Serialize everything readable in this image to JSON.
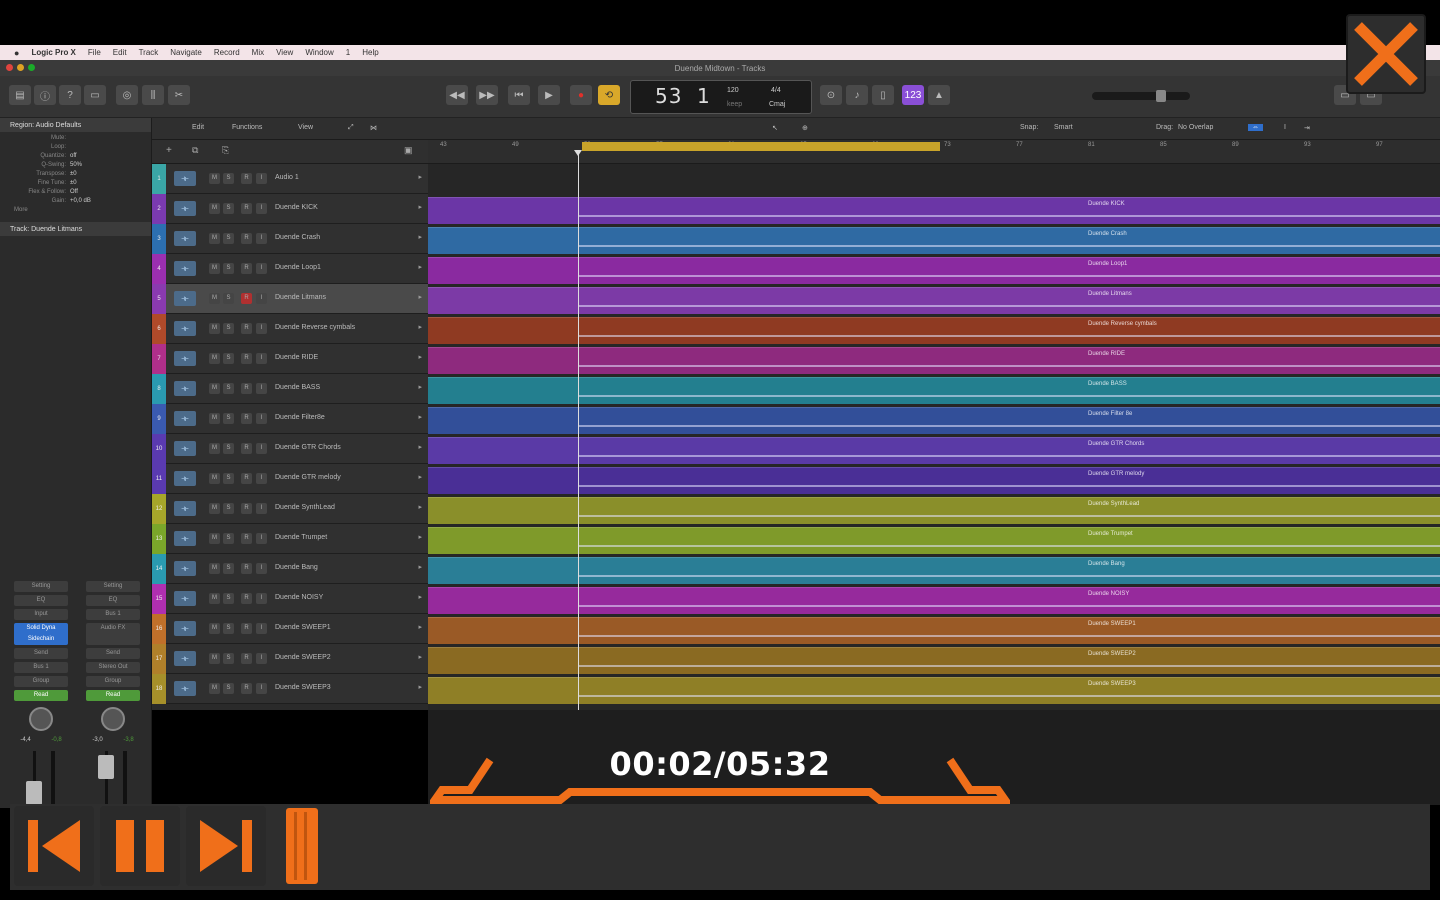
{
  "menubar": {
    "app_name": "Logic Pro X",
    "items": [
      "File",
      "Edit",
      "Track",
      "Navigate",
      "Record",
      "Mix",
      "View",
      "Window",
      "1",
      "Help"
    ]
  },
  "window": {
    "title": "Duende Midtown - Tracks"
  },
  "lcd": {
    "bar": "53",
    "beat": "1",
    "tempo": "120",
    "tempo_label": "keep",
    "signature": "4/4",
    "key": "Cmaj"
  },
  "inspector": {
    "region_header": "Region: Audio Defaults",
    "rows": [
      {
        "k": "Mute:",
        "v": ""
      },
      {
        "k": "Loop:",
        "v": ""
      },
      {
        "k": "Quantize:",
        "v": "off"
      },
      {
        "k": "Q-Swing:",
        "v": "50%"
      },
      {
        "k": "Transpose:",
        "v": "±0"
      },
      {
        "k": "Fine Tune:",
        "v": "±0"
      },
      {
        "k": "Flex & Follow:",
        "v": "Off"
      },
      {
        "k": "Gain:",
        "v": "+0,0 dB"
      }
    ],
    "more": "More",
    "track_header": "Track: Duende Litmans",
    "strip_left": {
      "setting": "Setting",
      "eq": "EQ",
      "input": "Input",
      "plugin": "Solid Dyna Sidechain",
      "send": "Send",
      "output": "Bus 1",
      "group": "Group",
      "automation": "Read",
      "vol": "-4,4",
      "peak": "-0,8"
    },
    "strip_right": {
      "setting": "Setting",
      "eq": "EQ",
      "input": "Bus 1",
      "plugin": "Audio FX",
      "send": "Send",
      "output": "Stereo Out",
      "group": "Group",
      "automation": "Read",
      "vol": "-3,0",
      "peak": "-3,8"
    }
  },
  "area_toolbar": {
    "edit": "Edit",
    "functions": "Functions",
    "view": "View",
    "snap_label": "Snap:",
    "snap_value": "Smart",
    "drag_label": "Drag:",
    "drag_value": "No Overlap"
  },
  "ruler": {
    "ticks": [
      "43",
      "49",
      "53",
      "57",
      "61",
      "65",
      "69",
      "73",
      "77",
      "81",
      "85",
      "89",
      "93",
      "97"
    ]
  },
  "tracks": [
    {
      "num": "1",
      "name": "Audio 1",
      "color": "#3aa6a6",
      "region": "",
      "lane": "#262626"
    },
    {
      "num": "2",
      "name": "Duende KICK",
      "color": "#7a3ab0",
      "region": "Duende KICK",
      "lane": "#6b36a6"
    },
    {
      "num": "3",
      "name": "Duende Crash",
      "color": "#2c6fb0",
      "region": "Duende Crash",
      "lane": "#2f6aa3"
    },
    {
      "num": "4",
      "name": "Duende Loop1",
      "color": "#9b2fb0",
      "region": "Duende Loop1",
      "lane": "#8a2aa0"
    },
    {
      "num": "5",
      "name": "Duende Litmans",
      "color": "#8a3ab0",
      "region": "Duende Litmans",
      "lane": "#7c3aa6"
    },
    {
      "num": "6",
      "name": "Duende Reverse cymbals",
      "color": "#b04a2a",
      "region": "Duende Reverse cymbals",
      "lane": "#8f3a22"
    },
    {
      "num": "7",
      "name": "Duende RIDE",
      "color": "#b02f8a",
      "region": "Duende RIDE",
      "lane": "#8e2a7e"
    },
    {
      "num": "8",
      "name": "Duende BASS",
      "color": "#2a9ab0",
      "region": "Duende BASS",
      "lane": "#237f8f"
    },
    {
      "num": "9",
      "name": "Duende Filter8e",
      "color": "#3a5ab0",
      "region": "Duende Filter 8e",
      "lane": "#324f99"
    },
    {
      "num": "10",
      "name": "Duende GTR Chords",
      "color": "#5a3ab0",
      "region": "Duende GTR Chords",
      "lane": "#5a3aa6"
    },
    {
      "num": "11",
      "name": "Duende GTR melody",
      "color": "#5a3ab0",
      "region": "Duende GTR melody",
      "lane": "#4a2f96"
    },
    {
      "num": "12",
      "name": "Duende SynthLead",
      "color": "#a6a62a",
      "region": "Duende SynthLead",
      "lane": "#8a8f2a"
    },
    {
      "num": "13",
      "name": "Duende Trumpet",
      "color": "#7aa62a",
      "region": "Duende Trumpet",
      "lane": "#7f9a2a"
    },
    {
      "num": "14",
      "name": "Duende Bang",
      "color": "#2a9ab0",
      "region": "Duende Bang",
      "lane": "#2a7e96"
    },
    {
      "num": "15",
      "name": "Duende NOISY",
      "color": "#b02fb0",
      "region": "Duende NOISY",
      "lane": "#962a9c"
    },
    {
      "num": "16",
      "name": "Duende SWEEP1",
      "color": "#c0702a",
      "region": "Duende SWEEP1",
      "lane": "#9a5a26"
    },
    {
      "num": "17",
      "name": "Duende SWEEP2",
      "color": "#b0802a",
      "region": "Duende SWEEP2",
      "lane": "#8a6a22"
    },
    {
      "num": "18",
      "name": "Duende SWEEP3",
      "color": "#a6902a",
      "region": "Duende SWEEP3",
      "lane": "#8f7f26"
    }
  ],
  "player": {
    "time": "00:02/05:32",
    "accent": "#f06f1a"
  }
}
